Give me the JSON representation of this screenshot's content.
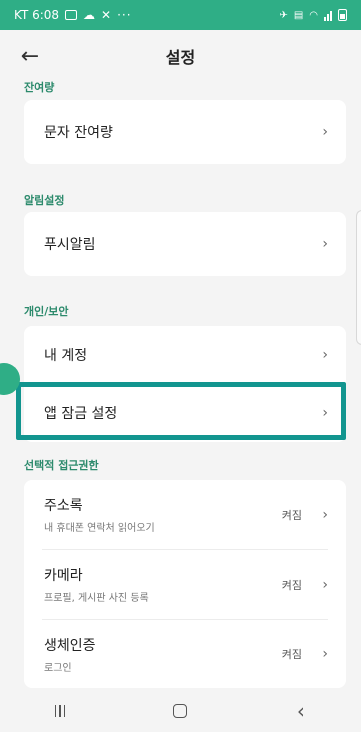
{
  "status_bar": {
    "carrier_time": "KT 6:08",
    "more": "···"
  },
  "header": {
    "title": "설정",
    "back_icon": "←"
  },
  "sections": {
    "balance": {
      "label": "잔여량",
      "items": [
        {
          "label": "문자 잔여량"
        }
      ]
    },
    "notifications": {
      "label": "알림설정",
      "items": [
        {
          "label": "푸시알림"
        }
      ]
    },
    "privacy": {
      "label": "개인/보안",
      "items": [
        {
          "label": "내 계정"
        },
        {
          "label": "앱 잠금 설정"
        }
      ]
    },
    "permissions": {
      "label": "선택적 접근권한",
      "items": [
        {
          "label": "주소록",
          "description": "내 휴대폰 연락처 읽어오기",
          "status": "켜짐"
        },
        {
          "label": "카메라",
          "description": "프로필, 게시판 사진 등록",
          "status": "켜짐"
        },
        {
          "label": "생체인증",
          "description": "로그인",
          "status": "켜짐"
        }
      ]
    }
  },
  "chevron": "›",
  "nav_back": "‹",
  "colors": {
    "accent": "#2fae86",
    "section_label": "#2c8a6c",
    "highlight": "#12958f",
    "background": "#f4f4f4"
  }
}
